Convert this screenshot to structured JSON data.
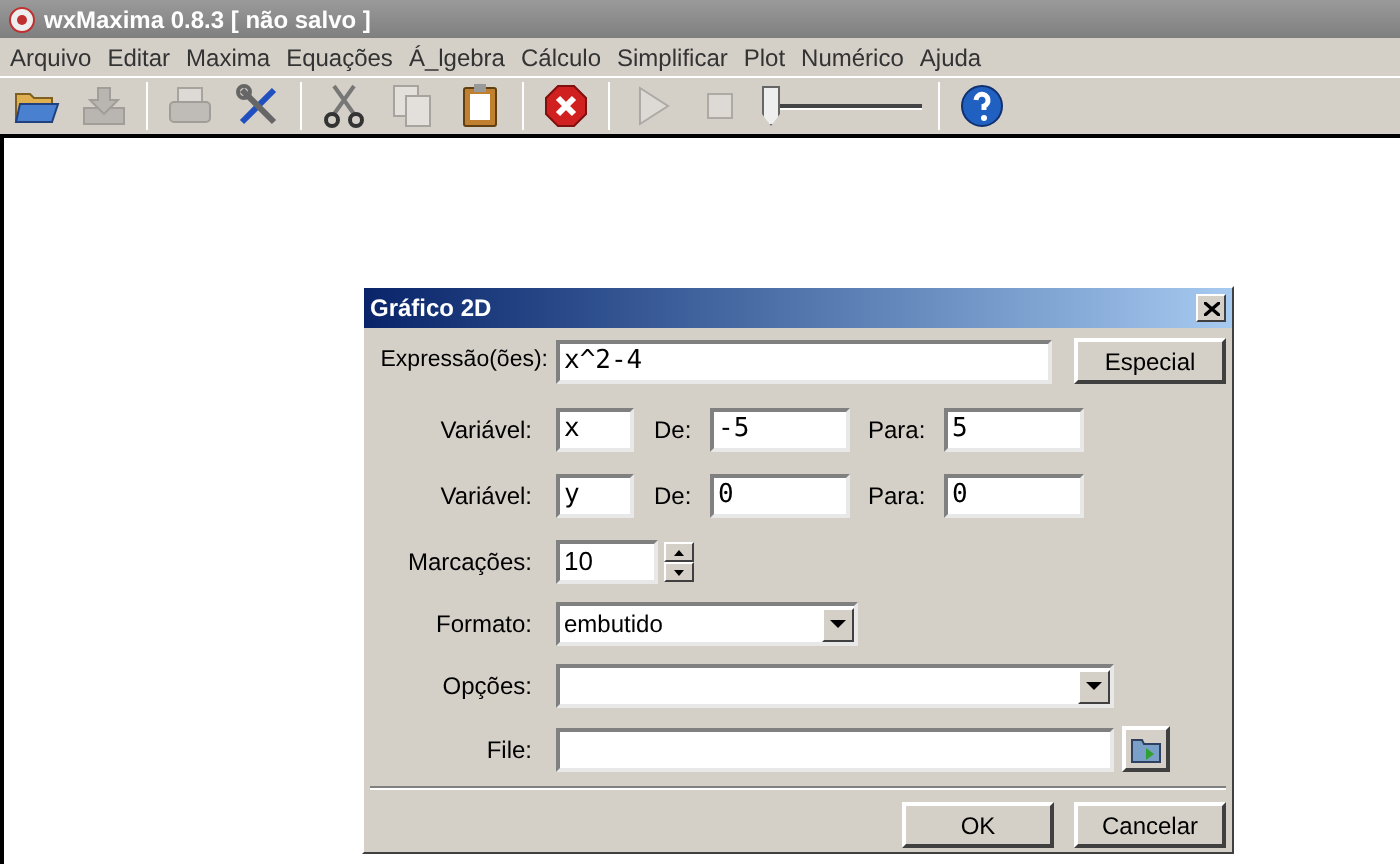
{
  "window": {
    "title": "wxMaxima 0.8.3 [ não salvo ]"
  },
  "menu": [
    "Arquivo",
    "Editar",
    "Maxima",
    "Equações",
    "Á_lgebra",
    "Cálculo",
    "Simplificar",
    "Plot",
    "Numérico",
    "Ajuda"
  ],
  "toolbar": [
    {
      "kind": "open",
      "disabled": false
    },
    {
      "kind": "save",
      "disabled": true
    },
    {
      "kind": "separator"
    },
    {
      "kind": "print",
      "disabled": true
    },
    {
      "kind": "tools",
      "disabled": false
    },
    {
      "kind": "separator"
    },
    {
      "kind": "cut",
      "disabled": false
    },
    {
      "kind": "copy",
      "disabled": true
    },
    {
      "kind": "paste",
      "disabled": false
    },
    {
      "kind": "separator"
    },
    {
      "kind": "interrupt",
      "disabled": false
    },
    {
      "kind": "separator"
    },
    {
      "kind": "play",
      "disabled": true
    },
    {
      "kind": "stop",
      "disabled": true
    },
    {
      "kind": "slider",
      "level": 0
    },
    {
      "kind": "separator"
    },
    {
      "kind": "help",
      "disabled": false
    }
  ],
  "dialog": {
    "title": "Gráfico 2D",
    "expression": {
      "label": "Expressão(ões):",
      "value": "x^2-4",
      "button": "Especial"
    },
    "variables": [
      {
        "label": "Variável:",
        "value": "x",
        "from_label": "De:",
        "from": "-5",
        "to_label": "Para:",
        "to": "5"
      },
      {
        "label": "Variável:",
        "value": "y",
        "from_label": "De:",
        "from": "0",
        "to_label": "Para:",
        "to": "0"
      }
    ],
    "ticks": {
      "label": "Marcações:",
      "value": "10"
    },
    "format": {
      "label": "Formato:",
      "value": "embutido"
    },
    "options": {
      "label": "Opções:"
    },
    "file": {
      "label": "File:"
    },
    "buttons": [
      "OK",
      "Cancelar"
    ]
  }
}
